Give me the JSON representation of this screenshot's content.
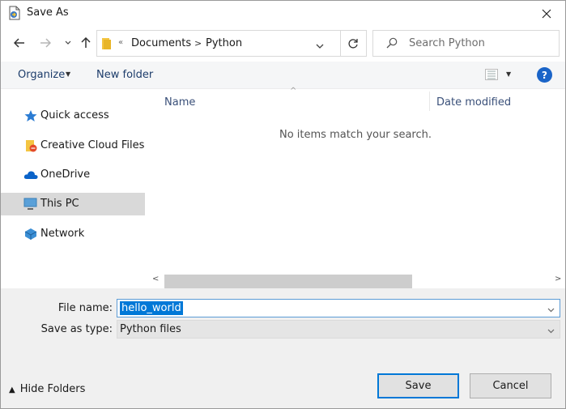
{
  "window": {
    "title": "Save As"
  },
  "address": {
    "breadcrumbs": [
      "Documents",
      "Python"
    ],
    "search_placeholder": "Search Python"
  },
  "toolbar": {
    "organize": "Organize",
    "new_folder": "New folder",
    "help": "?"
  },
  "nav": {
    "items": [
      {
        "label": "Quick access",
        "icon": "star-icon"
      },
      {
        "label": "Creative Cloud Files",
        "icon": "creative-cloud-folder-icon"
      },
      {
        "label": "OneDrive",
        "icon": "cloud-icon"
      },
      {
        "label": "This PC",
        "icon": "computer-icon",
        "selected": true
      },
      {
        "label": "Network",
        "icon": "network-icon"
      }
    ]
  },
  "file_list": {
    "columns": [
      "Name",
      "Date modified"
    ],
    "empty_message": "No items match your search."
  },
  "form": {
    "file_name_label": "File name:",
    "file_name_value": "hello_world",
    "save_as_type_label": "Save as type:",
    "save_as_type_value": "Python files"
  },
  "footer": {
    "hide_folders": "Hide Folders",
    "save": "Save",
    "cancel": "Cancel"
  },
  "colors": {
    "accent": "#0078d7",
    "link": "#1d3d6b",
    "selected_nav": "#d9d9d9",
    "help": "#1a64c8"
  }
}
